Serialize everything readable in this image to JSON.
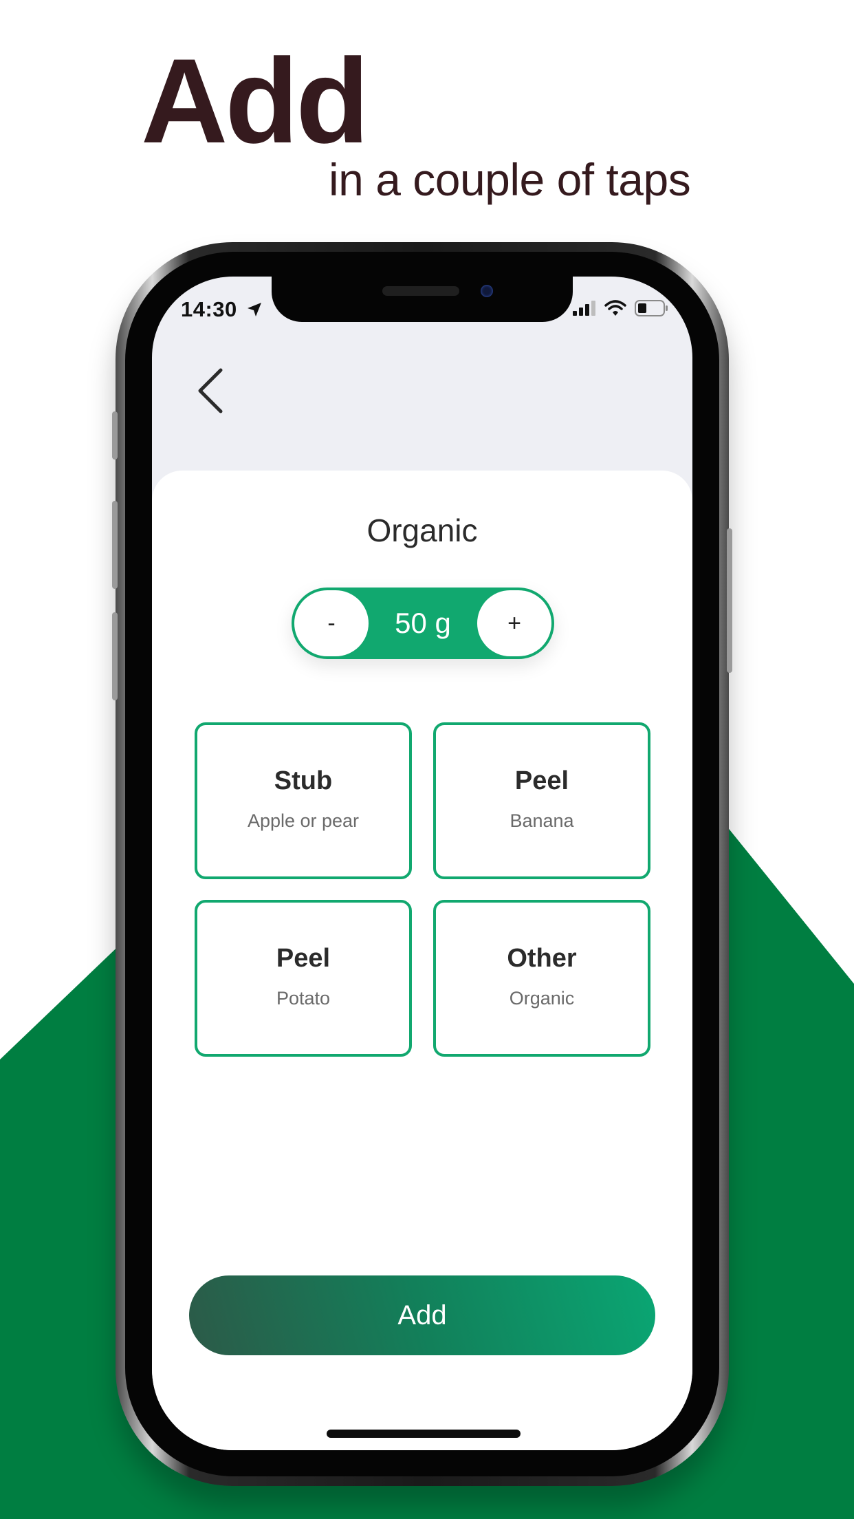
{
  "hero": {
    "title": "Add",
    "subtitle": "in a couple of taps"
  },
  "colors": {
    "brand_green": "#007e41",
    "accent_green": "#11a86f",
    "title_brown": "#351a1e"
  },
  "status_bar": {
    "time": "14:30",
    "icons": [
      "location-arrow-icon",
      "signal-icon",
      "wifi-icon",
      "battery-icon"
    ]
  },
  "screen": {
    "back_icon": "chevron-left-icon",
    "title": "Organic",
    "stepper": {
      "minus_label": "-",
      "value": "50 g",
      "plus_label": "+"
    },
    "options": [
      {
        "title": "Stub",
        "subtitle": "Apple or pear"
      },
      {
        "title": "Peel",
        "subtitle": "Banana"
      },
      {
        "title": "Peel",
        "subtitle": "Potato"
      },
      {
        "title": "Other",
        "subtitle": "Organic"
      }
    ],
    "add_label": "Add"
  }
}
